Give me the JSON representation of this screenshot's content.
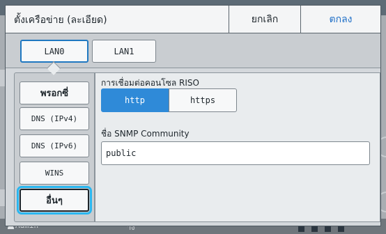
{
  "dialog": {
    "title": "ตั้งเครือข่าย (ละเอียด)",
    "cancel_label": "ยกเลิก",
    "ok_label": "ตกลง"
  },
  "lan_tabs": [
    {
      "label": "LAN0",
      "selected": true
    },
    {
      "label": "LAN1",
      "selected": false
    }
  ],
  "sidebar": {
    "items": [
      {
        "label": "พรอกซี่"
      },
      {
        "label": "DNS (IPv4)"
      },
      {
        "label": "DNS (IPv6)"
      },
      {
        "label": "WINS"
      },
      {
        "label": "อื่นๆ",
        "selected": true
      }
    ]
  },
  "content": {
    "console_label": "การเชื่อมต่อคอนโซล RISO",
    "protocol_options": [
      "http",
      "https"
    ],
    "protocol_selected": "http",
    "snmp_label": "ชื่อ SNMP Community",
    "snmp_value": "public"
  },
  "background": {
    "status_user": "Admin"
  },
  "colors": {
    "accent": "#2f8ad8",
    "selection_outline": "#2ab7f0",
    "ok_text": "#1f6fc7"
  }
}
